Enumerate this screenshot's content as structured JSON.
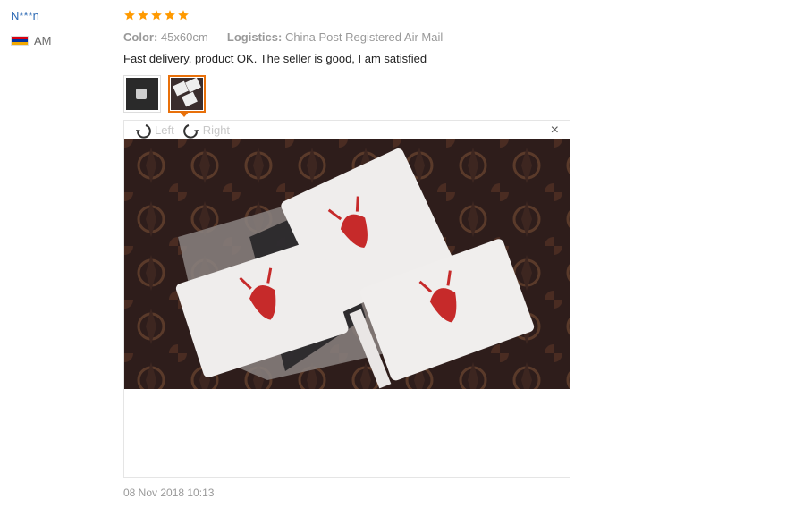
{
  "user": {
    "name": "N***n",
    "country": "AM",
    "flag_colors": [
      "#d90012",
      "#0033a0",
      "#f2a800"
    ]
  },
  "review": {
    "rating": 5,
    "star_color": "#ff9a00",
    "color_label": "Color:",
    "color_value": "45x60cm",
    "logistics_label": "Logistics:",
    "logistics_value": "China Post Registered Air Mail",
    "text": "Fast delivery, product OK. The seller is good, I am satisfied",
    "date": "08 Nov 2018 10:13"
  },
  "viewer": {
    "rotate_left": "Left",
    "rotate_right": "Right",
    "close": "×"
  }
}
